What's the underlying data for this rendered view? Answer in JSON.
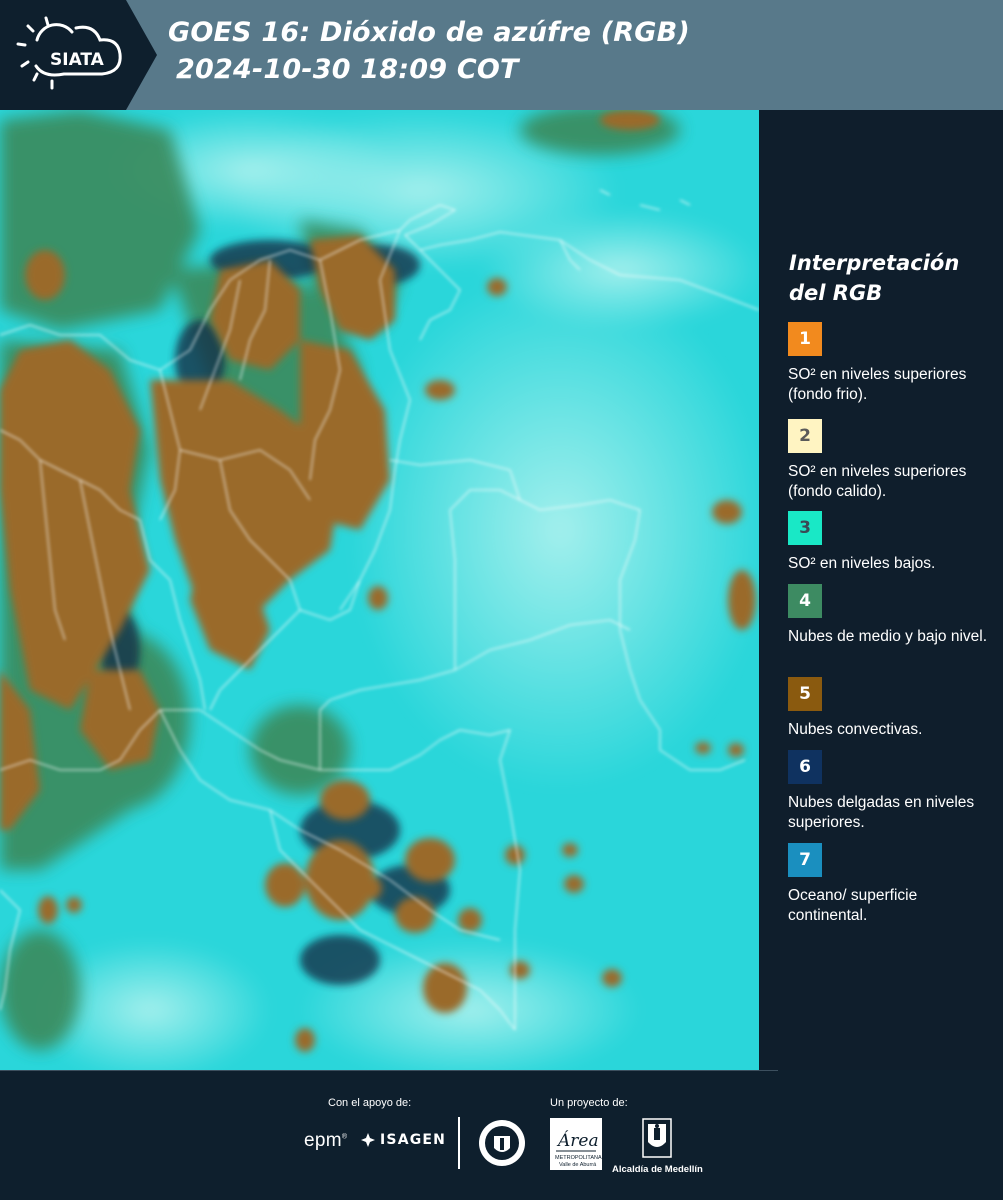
{
  "header": {
    "logo_text": "SIATA",
    "title_line1": "GOES 16: Dióxido de azúfre (RGB)",
    "title_line2": "2024-10-30 18:09 COT"
  },
  "legend": {
    "title": "Interpretación del RGB",
    "items": [
      {
        "number": "1",
        "color": "#f28a1e",
        "number_color": "#ffffff",
        "label": "SO² en niveles superiores (fondo frio)."
      },
      {
        "number": "2",
        "color": "#fff4c2",
        "number_color": "#5a5a5a",
        "label": "SO² en niveles superiores (fondo calido)."
      },
      {
        "number": "3",
        "color": "#19e8c6",
        "number_color": "#3a4a55",
        "label": "SO² en niveles bajos."
      },
      {
        "number": "4",
        "color": "#3d8b62",
        "number_color": "#ffffff",
        "label": "Nubes de medio y bajo nivel."
      },
      {
        "number": "5",
        "color": "#8a5a0f",
        "number_color": "#ffffff",
        "label": "Nubes convectivas."
      },
      {
        "number": "6",
        "color": "#0f3260",
        "number_color": "#ffffff",
        "label": "Nubes delgadas en niveles superiores."
      },
      {
        "number": "7",
        "color": "#1a8fbf",
        "number_color": "#ffffff",
        "label": "Oceano/ superficie continental."
      }
    ]
  },
  "footer": {
    "support_caption": "Con el apoyo de:",
    "project_caption": "Un proyecto de:",
    "epm_logo": "epm",
    "isagen_logo": "ISAGEN",
    "area_logo": "Área",
    "area_sub": "METROPOLITANA",
    "area_sub2": "Valle de Aburrá",
    "alcaldia_label": "Alcaldía de Medellín"
  },
  "colors": {
    "header_bg": "#58798a",
    "panel_bg": "#0f1e2c",
    "map_cyan": "#2ad6da",
    "convective_brown": "#9a6b2a",
    "mid_cloud_green": "#3a8a5a"
  }
}
